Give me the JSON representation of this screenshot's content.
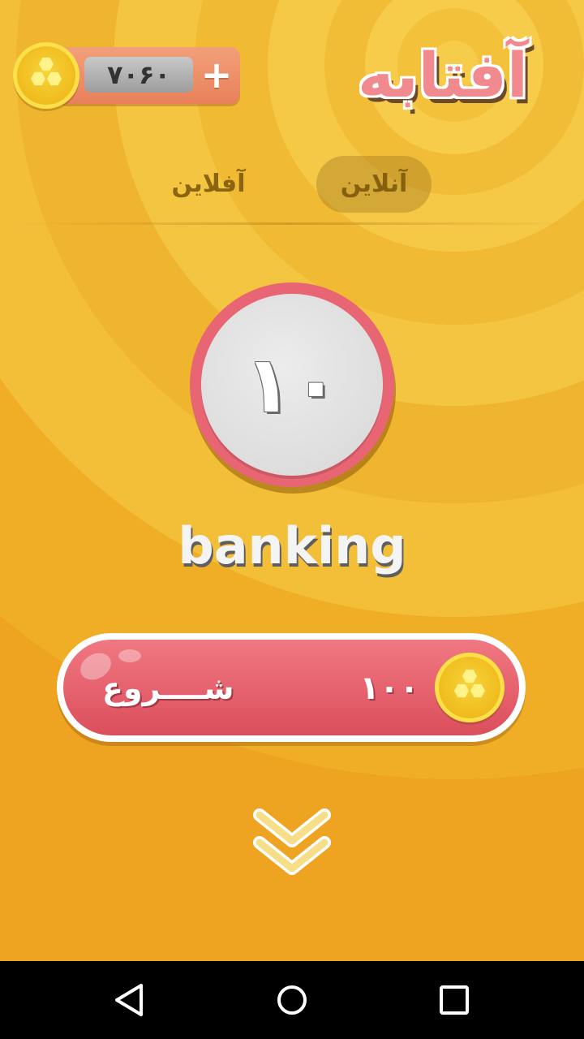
{
  "header": {
    "coin_count": "۷۰۶۰",
    "add_coins_label": "+",
    "logo_text": "آفتابه"
  },
  "tabs": [
    {
      "label": "آنلاین",
      "selected": true
    },
    {
      "label": "آفلاین",
      "selected": false
    }
  ],
  "game": {
    "level_number": "۱۰",
    "word": "banking"
  },
  "start_button": {
    "label": "شــــروع",
    "cost": "۱۰۰"
  },
  "icons": {
    "coin": "coin-icon",
    "plus": "plus-icon",
    "chevron": "double-chevron-down-icon",
    "nav_back": "back-triangle-icon",
    "nav_home": "home-circle-icon",
    "nav_recents": "recents-square-icon"
  },
  "colors": {
    "background": "#f3b72a",
    "accent_red": "#e35c69",
    "tab_selected": "#b98a2e"
  }
}
